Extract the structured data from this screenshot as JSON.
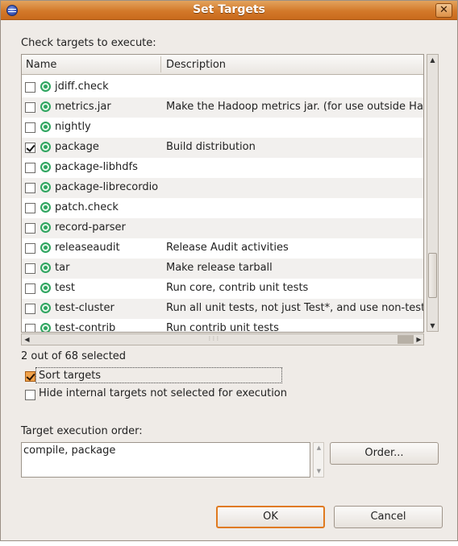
{
  "window": {
    "title": "Set Targets",
    "close_label": "✕"
  },
  "prompt_label": "Check targets to execute:",
  "table": {
    "columns": [
      "Name",
      "Description"
    ],
    "rows": [
      {
        "name": "jdiff.check",
        "description": "",
        "checked": false
      },
      {
        "name": "metrics.jar",
        "description": "Make the Hadoop metrics jar. (for use outside Had",
        "checked": false
      },
      {
        "name": "nightly",
        "description": "",
        "checked": false
      },
      {
        "name": "package",
        "description": "Build distribution",
        "checked": true
      },
      {
        "name": "package-libhdfs",
        "description": "",
        "checked": false
      },
      {
        "name": "package-librecordio",
        "description": "",
        "checked": false
      },
      {
        "name": "patch.check",
        "description": "",
        "checked": false
      },
      {
        "name": "record-parser",
        "description": "",
        "checked": false
      },
      {
        "name": "releaseaudit",
        "description": "Release Audit activities",
        "checked": false
      },
      {
        "name": "tar",
        "description": "Make release tarball",
        "checked": false
      },
      {
        "name": "test",
        "description": "Run core, contrib unit tests",
        "checked": false
      },
      {
        "name": "test-cluster",
        "description": "Run all unit tests, not just Test*, and use non-test",
        "checked": false
      },
      {
        "name": "test-contrib",
        "description": "Run contrib unit tests",
        "checked": false
      }
    ]
  },
  "selection_status": "2 out of 68 selected",
  "options": {
    "sort_targets": {
      "label": "Sort targets",
      "checked": true
    },
    "hide_internal": {
      "label": "Hide internal targets not selected for execution",
      "checked": false
    }
  },
  "execution_order": {
    "label": "Target execution order:",
    "value": "compile, package",
    "order_button": "Order..."
  },
  "buttons": {
    "ok": "OK",
    "cancel": "Cancel"
  },
  "colors": {
    "titlebar": "#d3792a",
    "dialog_bg": "#efebe7",
    "target_icon": "#2fa560",
    "default_button_border": "#e07a1f"
  },
  "icons": {
    "target": "ant-target-icon",
    "app": "eclipse-icon"
  }
}
